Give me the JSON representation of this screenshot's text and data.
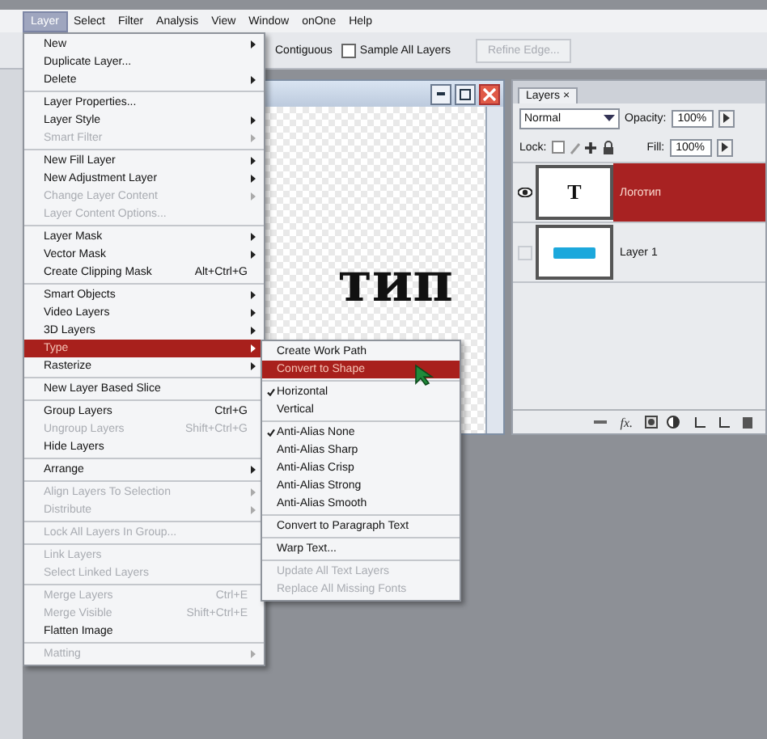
{
  "menubar": [
    {
      "label": "Layer",
      "selected": true
    },
    {
      "label": "Select",
      "selected": false
    },
    {
      "label": "Filter",
      "selected": false
    },
    {
      "label": "Analysis",
      "selected": false
    },
    {
      "label": "View",
      "selected": false
    },
    {
      "label": "Window",
      "selected": false
    },
    {
      "label": "onOne",
      "selected": false
    },
    {
      "label": "Help",
      "selected": false
    }
  ],
  "options_bar": {
    "contiguous": "Contiguous",
    "sample_all_layers": {
      "label": "Sample All Layers",
      "checked": false
    },
    "refine_edge": {
      "label": "Refine Edge...",
      "disabled": true
    }
  },
  "document": {
    "canvas_text": "тип"
  },
  "layer_menu": [
    [
      {
        "label": "New",
        "submenu": true,
        "disabled": false,
        "selected": false
      },
      {
        "label": "Duplicate Layer...",
        "submenu": false,
        "disabled": false,
        "selected": false
      },
      {
        "label": "Delete",
        "submenu": true,
        "disabled": false,
        "selected": false
      }
    ],
    [
      {
        "label": "Layer Properties...",
        "submenu": false,
        "disabled": false,
        "selected": false
      },
      {
        "label": "Layer Style",
        "submenu": true,
        "disabled": false,
        "selected": false
      },
      {
        "label": "Smart Filter",
        "submenu": true,
        "disabled": true,
        "selected": false
      }
    ],
    [
      {
        "label": "New Fill Layer",
        "submenu": true,
        "disabled": false,
        "selected": false
      },
      {
        "label": "New Adjustment Layer",
        "submenu": true,
        "disabled": false,
        "selected": false
      },
      {
        "label": "Change Layer Content",
        "submenu": true,
        "disabled": true,
        "selected": false
      },
      {
        "label": "Layer Content Options...",
        "submenu": false,
        "disabled": true,
        "selected": false
      }
    ],
    [
      {
        "label": "Layer Mask",
        "submenu": true,
        "disabled": false,
        "selected": false
      },
      {
        "label": "Vector Mask",
        "submenu": true,
        "disabled": false,
        "selected": false
      },
      {
        "label": "Create Clipping Mask",
        "shortcut": "Alt+Ctrl+G",
        "submenu": false,
        "disabled": false,
        "selected": false
      }
    ],
    [
      {
        "label": "Smart Objects",
        "submenu": true,
        "disabled": false,
        "selected": false
      },
      {
        "label": "Video Layers",
        "submenu": true,
        "disabled": false,
        "selected": false
      },
      {
        "label": "3D Layers",
        "submenu": true,
        "disabled": false,
        "selected": false
      },
      {
        "label": "Type",
        "submenu": true,
        "disabled": false,
        "selected": true
      },
      {
        "label": "Rasterize",
        "submenu": true,
        "disabled": false,
        "selected": false
      }
    ],
    [
      {
        "label": "New Layer Based Slice",
        "submenu": false,
        "disabled": false,
        "selected": false
      }
    ],
    [
      {
        "label": "Group Layers",
        "shortcut": "Ctrl+G",
        "submenu": false,
        "disabled": false,
        "selected": false
      },
      {
        "label": "Ungroup Layers",
        "shortcut": "Shift+Ctrl+G",
        "submenu": false,
        "disabled": true,
        "selected": false
      },
      {
        "label": "Hide Layers",
        "submenu": false,
        "disabled": false,
        "selected": false
      }
    ],
    [
      {
        "label": "Arrange",
        "submenu": true,
        "disabled": false,
        "selected": false
      }
    ],
    [
      {
        "label": "Align Layers To Selection",
        "submenu": true,
        "disabled": true,
        "selected": false
      },
      {
        "label": "Distribute",
        "submenu": true,
        "disabled": true,
        "selected": false
      }
    ],
    [
      {
        "label": "Lock All Layers In Group...",
        "submenu": false,
        "disabled": true,
        "selected": false
      }
    ],
    [
      {
        "label": "Link Layers",
        "submenu": false,
        "disabled": true,
        "selected": false
      },
      {
        "label": "Select Linked Layers",
        "submenu": false,
        "disabled": true,
        "selected": false
      }
    ],
    [
      {
        "label": "Merge Layers",
        "shortcut": "Ctrl+E",
        "submenu": false,
        "disabled": true,
        "selected": false
      },
      {
        "label": "Merge Visible",
        "shortcut": "Shift+Ctrl+E",
        "submenu": false,
        "disabled": true,
        "selected": false
      },
      {
        "label": "Flatten Image",
        "submenu": false,
        "disabled": false,
        "selected": false
      }
    ],
    [
      {
        "label": "Matting",
        "submenu": true,
        "disabled": true,
        "selected": false
      }
    ]
  ],
  "type_submenu": [
    [
      {
        "label": "Create Work Path",
        "checked": false,
        "disabled": false,
        "selected": false
      },
      {
        "label": "Convert to Shape",
        "checked": false,
        "disabled": false,
        "selected": true
      }
    ],
    [
      {
        "label": "Horizontal",
        "checked": true,
        "disabled": false,
        "selected": false
      },
      {
        "label": "Vertical",
        "checked": false,
        "disabled": false,
        "selected": false
      }
    ],
    [
      {
        "label": "Anti-Alias None",
        "checked": true,
        "disabled": false,
        "selected": false
      },
      {
        "label": "Anti-Alias Sharp",
        "checked": false,
        "disabled": false,
        "selected": false
      },
      {
        "label": "Anti-Alias Crisp",
        "checked": false,
        "disabled": false,
        "selected": false
      },
      {
        "label": "Anti-Alias Strong",
        "checked": false,
        "disabled": false,
        "selected": false
      },
      {
        "label": "Anti-Alias Smooth",
        "checked": false,
        "disabled": false,
        "selected": false
      }
    ],
    [
      {
        "label": "Convert to Paragraph Text",
        "checked": false,
        "disabled": false,
        "selected": false
      }
    ],
    [
      {
        "label": "Warp Text...",
        "checked": false,
        "disabled": false,
        "selected": false
      }
    ],
    [
      {
        "label": "Update All Text Layers",
        "checked": false,
        "disabled": true,
        "selected": false
      },
      {
        "label": "Replace All Missing Fonts",
        "checked": false,
        "disabled": true,
        "selected": false
      }
    ]
  ],
  "layers_panel": {
    "fx_label": "fx.",
    "tab": "Layers",
    "close": "×",
    "blend_mode": "Normal",
    "opacity_label": "Opacity:",
    "opacity": "100%",
    "lock_label": "Lock:",
    "fill_label": "Fill:",
    "fill": "100%",
    "layers": [
      {
        "name": "Логотип",
        "kind": "text",
        "thumb_text": "T",
        "visible": true,
        "selected": true
      },
      {
        "name": "Layer 1",
        "kind": "image",
        "visible": false,
        "selected": false
      }
    ]
  }
}
